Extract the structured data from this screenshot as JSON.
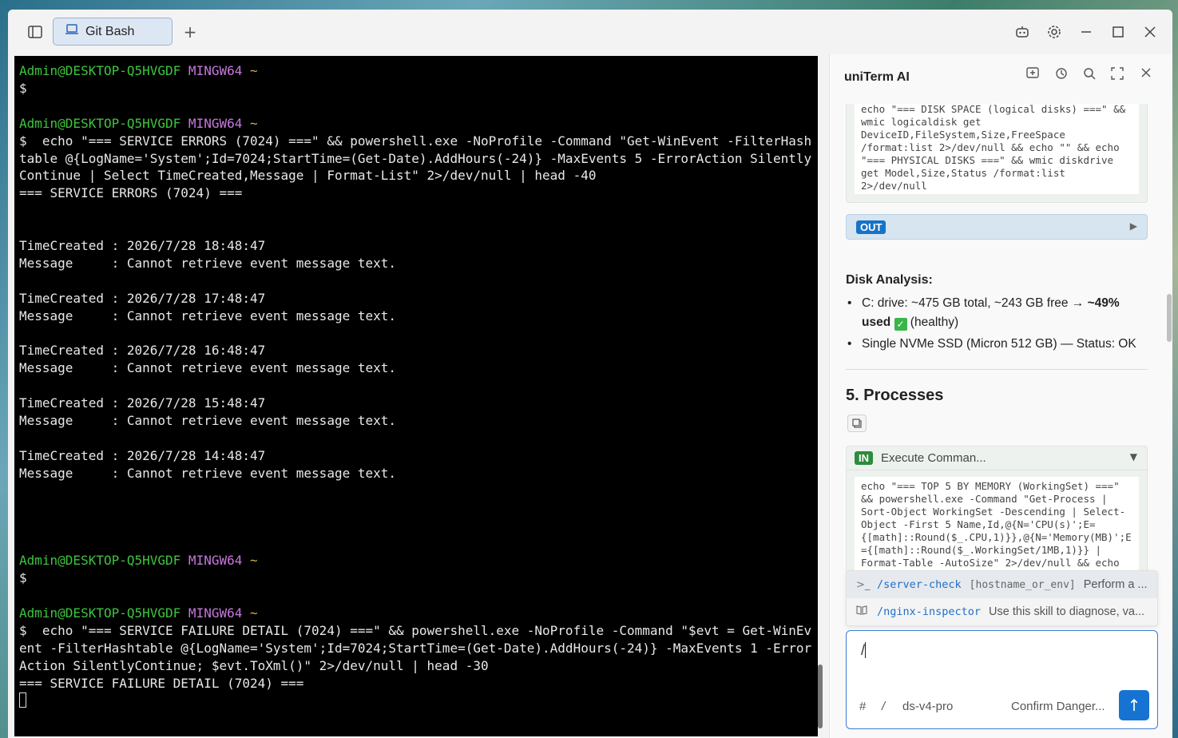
{
  "titlebar": {
    "tab_label": "Git Bash",
    "add_tab_label": "+"
  },
  "terminal": {
    "prompt": {
      "user": "Admin@DESKTOP-Q5HVGDF",
      "host": "MINGW64",
      "path": "~"
    },
    "lines": [
      "$",
      "",
      "$  echo \"=== SERVICE ERRORS (7024) ===\" && powershell.exe -NoProfile -Command \"Get-WinEvent -FilterHashtable @{LogName='System';Id=7024;StartTime=(Get-Date).AddHours(-24)} -MaxEvents 5 -ErrorAction SilentlyContinue | Select TimeCreated,Message | Format-List\" 2>/dev/null | head -40",
      "=== SERVICE ERRORS (7024) ===",
      "",
      "",
      "TimeCreated : 2026/7/28 18:48:47",
      "Message     : Cannot retrieve event message text.",
      "",
      "TimeCreated : 2026/7/28 17:48:47",
      "Message     : Cannot retrieve event message text.",
      "",
      "TimeCreated : 2026/7/28 16:48:47",
      "Message     : Cannot retrieve event message text.",
      "",
      "TimeCreated : 2026/7/28 15:48:47",
      "Message     : Cannot retrieve event message text.",
      "",
      "TimeCreated : 2026/7/28 14:48:47",
      "Message     : Cannot retrieve event message text.",
      "",
      "",
      "",
      "",
      "$",
      "",
      "$  echo \"=== SERVICE FAILURE DETAIL (7024) ===\" && powershell.exe -NoProfile -Command \"$evt = Get-WinEvent -FilterHashtable @{LogName='System';Id=7024;StartTime=(Get-Date).AddHours(-24)} -MaxEvents 1 -ErrorAction SilentlyContinue; $evt.ToXml()\" 2>/dev/null | head -30",
      "=== SERVICE FAILURE DETAIL (7024) ==="
    ]
  },
  "panel": {
    "title": "uniTerm AI",
    "prev_code": "echo \"=== DISK SPACE (logical disks) ===\" &&\nwmic logicaldisk get\nDeviceID,FileSystem,Size,FreeSpace\n/format:list 2>/dev/null && echo \"\" && echo\n\"=== PHYSICAL DISKS ===\" && wmic diskdrive\nget Model,Size,Status /format:list\n2>/dev/null",
    "out_badge": "OUT",
    "disk_heading": "Disk Analysis:",
    "disk_item1_a": "C: drive: ~475 GB total, ~243 GB free → ",
    "disk_item1_b": "~49% used",
    "disk_item1_c": " (healthy)",
    "disk_item2": "Single NVMe SSD (Micron 512 GB) — Status: OK",
    "section_title": "5. Processes",
    "in_badge": "IN",
    "in_title": "Execute Comman...",
    "in_code": "echo \"=== TOP 5 BY MEMORY (WorkingSet) ===\"\n&& powershell.exe -Command \"Get-Process |\nSort-Object WorkingSet -Descending | Select-\nObject -First 5 Name,Id,@{N='CPU(s)';E=\n{[math]::Round($_.CPU,1)}},@{N='Memory(MB)';E\n={[math]::Round($_.WorkingSet/1MB,1)}} |\nFormat-Table -AutoSize\" 2>/dev/null && echo"
  },
  "suggestions": [
    {
      "cmd": "/server-check",
      "param": "[hostname_or_env]",
      "desc": "Perform a ..."
    },
    {
      "cmd": "/nginx-inspector",
      "param": "",
      "desc": "Use this skill to diagnose, va..."
    }
  ],
  "input": {
    "value": "/",
    "hash": "#",
    "slash": "/",
    "model": "ds-v4-pro",
    "confirm": "Confirm Danger...",
    "send": "↑"
  }
}
